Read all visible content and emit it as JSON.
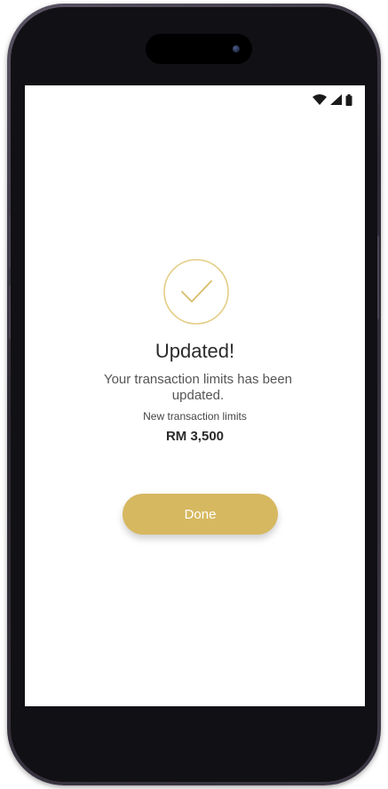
{
  "status_bar": {
    "wifi_icon": "wifi-icon",
    "signal_icon": "cellular-signal-icon",
    "battery_icon": "battery-icon"
  },
  "confirmation": {
    "icon": "checkmark-circle-icon",
    "title": "Updated!",
    "message": "Your transaction limits has been updated.",
    "limit_label": "New transaction limits",
    "limit_value": "RM 3,500"
  },
  "actions": {
    "done_label": "Done"
  },
  "colors": {
    "accent": "#d6b860",
    "title_text": "#2b2b2b",
    "body_text": "#555555"
  }
}
